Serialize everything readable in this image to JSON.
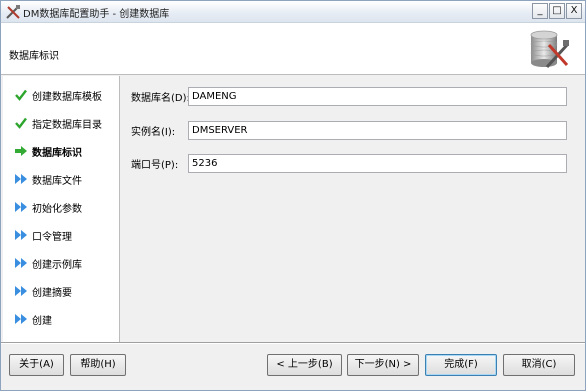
{
  "window": {
    "title": "DM数据库配置助手 - 创建数据库",
    "controls": {
      "minimize": "_",
      "maximize": "□",
      "close": "X"
    }
  },
  "header": {
    "title": "数据库标识"
  },
  "steps": [
    {
      "label": "创建数据库模板",
      "status": "done"
    },
    {
      "label": "指定数据库目录",
      "status": "done"
    },
    {
      "label": "数据库标识",
      "status": "current"
    },
    {
      "label": "数据库文件",
      "status": "pending"
    },
    {
      "label": "初始化参数",
      "status": "pending"
    },
    {
      "label": "口令管理",
      "status": "pending"
    },
    {
      "label": "创建示例库",
      "status": "pending"
    },
    {
      "label": "创建摘要",
      "status": "pending"
    },
    {
      "label": "创建",
      "status": "pending"
    }
  ],
  "form": {
    "db_name": {
      "label": "数据库名(D):",
      "value": "DAMENG"
    },
    "instance_name": {
      "label": "实例名(I):",
      "value": "DMSERVER"
    },
    "port": {
      "label": "端口号(P):",
      "value": "5236"
    }
  },
  "buttons": {
    "about": "关于(A)",
    "help": "帮助(H)",
    "prev": "< 上一步(B)",
    "next": "下一步(N) >",
    "finish": "完成(F)",
    "cancel": "取消(C)"
  },
  "colors": {
    "done": "#2ea62e",
    "current": "#33aa33",
    "pending": "#3a8ee0"
  }
}
